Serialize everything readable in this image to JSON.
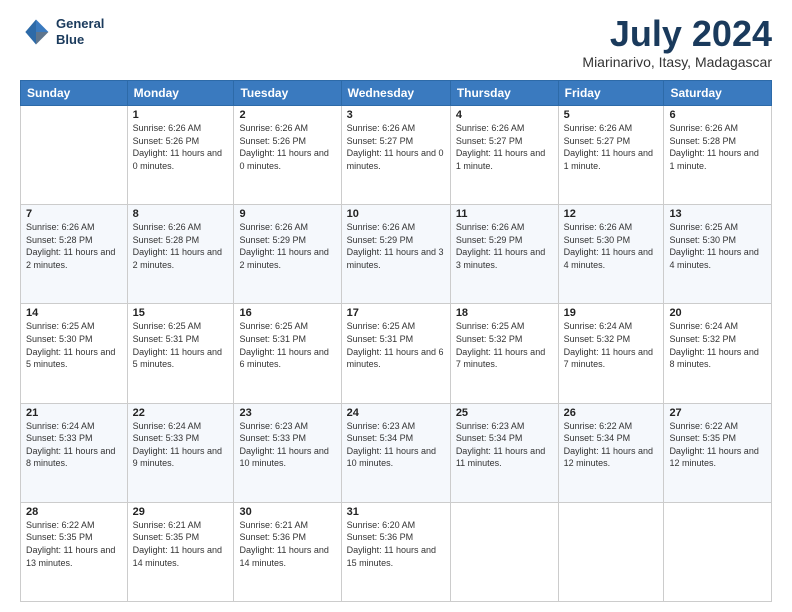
{
  "logo": {
    "line1": "General",
    "line2": "Blue"
  },
  "title": {
    "month_year": "July 2024",
    "location": "Miarinarivo, Itasy, Madagascar"
  },
  "weekdays": [
    "Sunday",
    "Monday",
    "Tuesday",
    "Wednesday",
    "Thursday",
    "Friday",
    "Saturday"
  ],
  "weeks": [
    [
      {
        "day": "",
        "sunrise": "",
        "sunset": "",
        "daylight": ""
      },
      {
        "day": "1",
        "sunrise": "Sunrise: 6:26 AM",
        "sunset": "Sunset: 5:26 PM",
        "daylight": "Daylight: 11 hours and 0 minutes."
      },
      {
        "day": "2",
        "sunrise": "Sunrise: 6:26 AM",
        "sunset": "Sunset: 5:26 PM",
        "daylight": "Daylight: 11 hours and 0 minutes."
      },
      {
        "day": "3",
        "sunrise": "Sunrise: 6:26 AM",
        "sunset": "Sunset: 5:27 PM",
        "daylight": "Daylight: 11 hours and 0 minutes."
      },
      {
        "day": "4",
        "sunrise": "Sunrise: 6:26 AM",
        "sunset": "Sunset: 5:27 PM",
        "daylight": "Daylight: 11 hours and 1 minute."
      },
      {
        "day": "5",
        "sunrise": "Sunrise: 6:26 AM",
        "sunset": "Sunset: 5:27 PM",
        "daylight": "Daylight: 11 hours and 1 minute."
      },
      {
        "day": "6",
        "sunrise": "Sunrise: 6:26 AM",
        "sunset": "Sunset: 5:28 PM",
        "daylight": "Daylight: 11 hours and 1 minute."
      }
    ],
    [
      {
        "day": "7",
        "sunrise": "Sunrise: 6:26 AM",
        "sunset": "Sunset: 5:28 PM",
        "daylight": "Daylight: 11 hours and 2 minutes."
      },
      {
        "day": "8",
        "sunrise": "Sunrise: 6:26 AM",
        "sunset": "Sunset: 5:28 PM",
        "daylight": "Daylight: 11 hours and 2 minutes."
      },
      {
        "day": "9",
        "sunrise": "Sunrise: 6:26 AM",
        "sunset": "Sunset: 5:29 PM",
        "daylight": "Daylight: 11 hours and 2 minutes."
      },
      {
        "day": "10",
        "sunrise": "Sunrise: 6:26 AM",
        "sunset": "Sunset: 5:29 PM",
        "daylight": "Daylight: 11 hours and 3 minutes."
      },
      {
        "day": "11",
        "sunrise": "Sunrise: 6:26 AM",
        "sunset": "Sunset: 5:29 PM",
        "daylight": "Daylight: 11 hours and 3 minutes."
      },
      {
        "day": "12",
        "sunrise": "Sunrise: 6:26 AM",
        "sunset": "Sunset: 5:30 PM",
        "daylight": "Daylight: 11 hours and 4 minutes."
      },
      {
        "day": "13",
        "sunrise": "Sunrise: 6:25 AM",
        "sunset": "Sunset: 5:30 PM",
        "daylight": "Daylight: 11 hours and 4 minutes."
      }
    ],
    [
      {
        "day": "14",
        "sunrise": "Sunrise: 6:25 AM",
        "sunset": "Sunset: 5:30 PM",
        "daylight": "Daylight: 11 hours and 5 minutes."
      },
      {
        "day": "15",
        "sunrise": "Sunrise: 6:25 AM",
        "sunset": "Sunset: 5:31 PM",
        "daylight": "Daylight: 11 hours and 5 minutes."
      },
      {
        "day": "16",
        "sunrise": "Sunrise: 6:25 AM",
        "sunset": "Sunset: 5:31 PM",
        "daylight": "Daylight: 11 hours and 6 minutes."
      },
      {
        "day": "17",
        "sunrise": "Sunrise: 6:25 AM",
        "sunset": "Sunset: 5:31 PM",
        "daylight": "Daylight: 11 hours and 6 minutes."
      },
      {
        "day": "18",
        "sunrise": "Sunrise: 6:25 AM",
        "sunset": "Sunset: 5:32 PM",
        "daylight": "Daylight: 11 hours and 7 minutes."
      },
      {
        "day": "19",
        "sunrise": "Sunrise: 6:24 AM",
        "sunset": "Sunset: 5:32 PM",
        "daylight": "Daylight: 11 hours and 7 minutes."
      },
      {
        "day": "20",
        "sunrise": "Sunrise: 6:24 AM",
        "sunset": "Sunset: 5:32 PM",
        "daylight": "Daylight: 11 hours and 8 minutes."
      }
    ],
    [
      {
        "day": "21",
        "sunrise": "Sunrise: 6:24 AM",
        "sunset": "Sunset: 5:33 PM",
        "daylight": "Daylight: 11 hours and 8 minutes."
      },
      {
        "day": "22",
        "sunrise": "Sunrise: 6:24 AM",
        "sunset": "Sunset: 5:33 PM",
        "daylight": "Daylight: 11 hours and 9 minutes."
      },
      {
        "day": "23",
        "sunrise": "Sunrise: 6:23 AM",
        "sunset": "Sunset: 5:33 PM",
        "daylight": "Daylight: 11 hours and 10 minutes."
      },
      {
        "day": "24",
        "sunrise": "Sunrise: 6:23 AM",
        "sunset": "Sunset: 5:34 PM",
        "daylight": "Daylight: 11 hours and 10 minutes."
      },
      {
        "day": "25",
        "sunrise": "Sunrise: 6:23 AM",
        "sunset": "Sunset: 5:34 PM",
        "daylight": "Daylight: 11 hours and 11 minutes."
      },
      {
        "day": "26",
        "sunrise": "Sunrise: 6:22 AM",
        "sunset": "Sunset: 5:34 PM",
        "daylight": "Daylight: 11 hours and 12 minutes."
      },
      {
        "day": "27",
        "sunrise": "Sunrise: 6:22 AM",
        "sunset": "Sunset: 5:35 PM",
        "daylight": "Daylight: 11 hours and 12 minutes."
      }
    ],
    [
      {
        "day": "28",
        "sunrise": "Sunrise: 6:22 AM",
        "sunset": "Sunset: 5:35 PM",
        "daylight": "Daylight: 11 hours and 13 minutes."
      },
      {
        "day": "29",
        "sunrise": "Sunrise: 6:21 AM",
        "sunset": "Sunset: 5:35 PM",
        "daylight": "Daylight: 11 hours and 14 minutes."
      },
      {
        "day": "30",
        "sunrise": "Sunrise: 6:21 AM",
        "sunset": "Sunset: 5:36 PM",
        "daylight": "Daylight: 11 hours and 14 minutes."
      },
      {
        "day": "31",
        "sunrise": "Sunrise: 6:20 AM",
        "sunset": "Sunset: 5:36 PM",
        "daylight": "Daylight: 11 hours and 15 minutes."
      },
      {
        "day": "",
        "sunrise": "",
        "sunset": "",
        "daylight": ""
      },
      {
        "day": "",
        "sunrise": "",
        "sunset": "",
        "daylight": ""
      },
      {
        "day": "",
        "sunrise": "",
        "sunset": "",
        "daylight": ""
      }
    ]
  ]
}
